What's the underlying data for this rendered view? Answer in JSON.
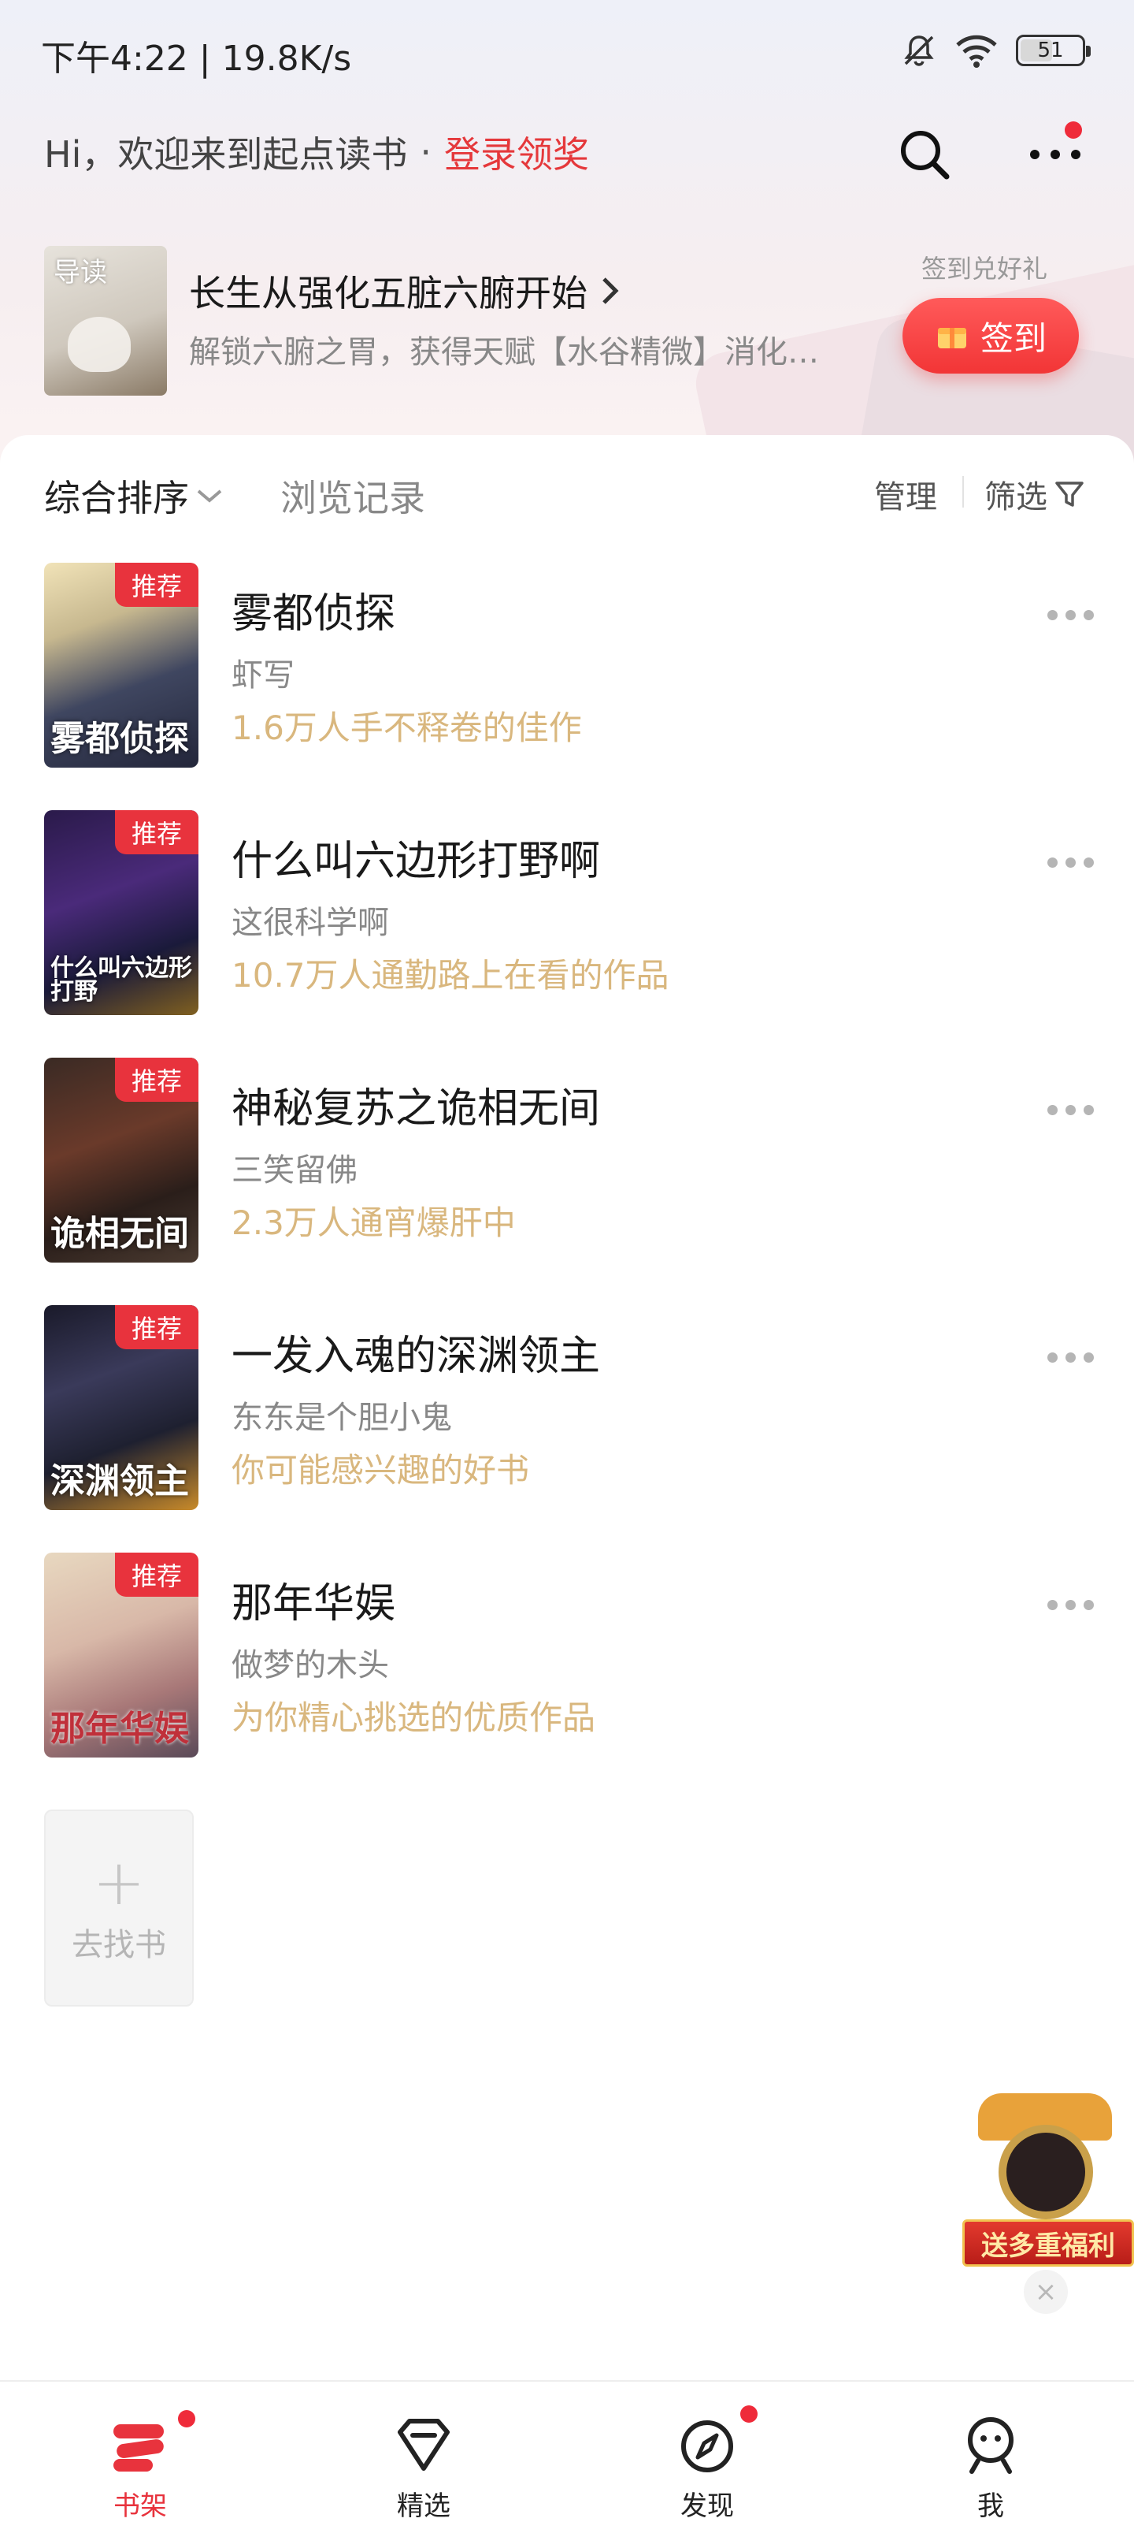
{
  "status_bar": {
    "time": "下午4:22 | 19.8K/s",
    "battery": "51",
    "icons": [
      "mute-icon",
      "wifi-icon",
      "battery-icon"
    ]
  },
  "header": {
    "greeting": "Hi，欢迎来到起点读书",
    "separator": "·",
    "login_link": "登录领奖",
    "icons": [
      "search-icon",
      "more-icon"
    ]
  },
  "banner": {
    "cover_tag": "导读",
    "title": "长生从强化五脏六腑开始",
    "description": "解锁六腑之胃，获得天赋【水谷精微】消化…",
    "signin_hint": "签到兑好礼",
    "signin_label": "签到"
  },
  "toolbar": {
    "sort_label": "综合排序",
    "history_label": "浏览记录",
    "manage_label": "管理",
    "filter_label": "筛选"
  },
  "books": [
    {
      "title": "雾都侦探",
      "author": "虾写",
      "note": "1.6万人手不释卷的佳作",
      "badge": "推荐",
      "cover_text": "雾都侦探"
    },
    {
      "title": "什么叫六边形打野啊",
      "author": "这很科学啊",
      "note": "10.7万人通勤路上在看的作品",
      "badge": "推荐",
      "cover_text": "什么叫六边形打野"
    },
    {
      "title": "神秘复苏之诡相无间",
      "author": "三笑留佛",
      "note": "2.3万人通宵爆肝中",
      "badge": "推荐",
      "cover_text": "诡相无间"
    },
    {
      "title": "一发入魂的深渊领主",
      "author": "东东是个胆小鬼",
      "note": "你可能感兴趣的好书",
      "badge": "推荐",
      "cover_text": "深渊领主"
    },
    {
      "title": "那年华娱",
      "author": "做梦的木头",
      "note": "为你精心挑选的优质作品",
      "badge": "推荐",
      "cover_text": "那年华娱"
    }
  ],
  "add_book": {
    "plus": "+",
    "label": "去找书"
  },
  "promo": {
    "banner_text": "送多重福利",
    "close": "×"
  },
  "bottom_nav": [
    {
      "label": "书架",
      "icon": "bookshelf-icon",
      "active": true
    },
    {
      "label": "精选",
      "icon": "diamond-icon",
      "active": false
    },
    {
      "label": "发现",
      "icon": "compass-icon",
      "active": false
    },
    {
      "label": "我",
      "icon": "profile-icon",
      "active": false
    }
  ],
  "colors": {
    "accent": "#e8333d",
    "note_gold": "#d9b77e"
  }
}
